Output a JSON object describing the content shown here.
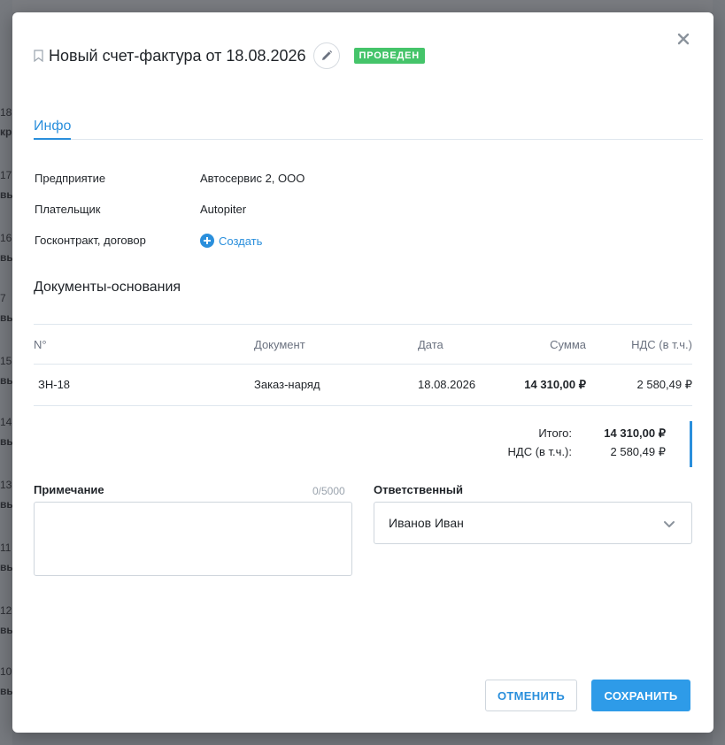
{
  "background": {
    "left_numbers": [
      "18",
      "17",
      "16",
      "7",
      "15",
      "14",
      "13",
      "11",
      "12",
      "10"
    ],
    "left_words": [
      "кр",
      "вы",
      "вы",
      "вы",
      "вы",
      "вы",
      "вы",
      "вы",
      "вы",
      "вы"
    ]
  },
  "modal": {
    "title": "Новый счет-фактура от 18.08.2026",
    "status": "ПРОВЕДЕН",
    "tab_info": "Инфо",
    "fields": {
      "enterprise_label": "Предприятие",
      "enterprise_value": "Автосервис 2, ООО",
      "payer_label": "Плательщик",
      "payer_value": "Autopiter",
      "contract_label": "Госконтракт, договор",
      "create_label": "Создать"
    },
    "documents_title": "Документы-основания",
    "table": {
      "headers": [
        "N°",
        "Документ",
        "Дата",
        "Сумма",
        "НДС (в т.ч.)"
      ],
      "rows": [
        [
          "ЗН-18",
          "Заказ-наряд",
          "18.08.2026",
          "14 310,00 ₽",
          "2 580,49 ₽"
        ]
      ]
    },
    "totals": {
      "total_label": "Итого:",
      "total_value": "14 310,00 ₽",
      "vat_label": "НДС (в т.ч.):",
      "vat_value": "2 580,49 ₽"
    },
    "note_label": "Примечание",
    "note_counter": "0/5000",
    "note_value": "",
    "responsible_label": "Ответственный",
    "responsible_value": "Иванов Иван",
    "cancel_label": "ОТМЕНИТЬ",
    "save_label": "СОХРАНИТЬ"
  },
  "colors": {
    "accent": "#2a8fdc",
    "status_green": "#45c46a",
    "save_button": "#2e9be8"
  }
}
